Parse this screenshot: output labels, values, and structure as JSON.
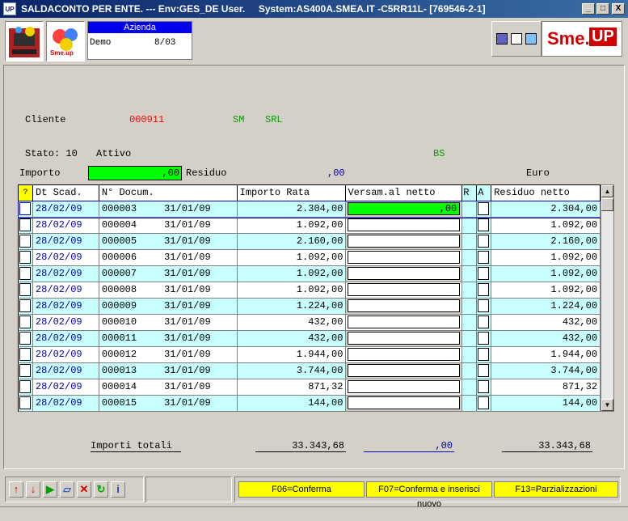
{
  "window": {
    "app_icon": "UP",
    "title": "SALDACONTO PER ENTE. --- Env:GES_DE User.     System:AS400A.SMEA.IT -C5RR11L- [769546-2-1]",
    "controls": [
      "_",
      "□",
      "X"
    ]
  },
  "header": {
    "azienda_title": "Azienda",
    "azienda_name": "Demo",
    "azienda_period": "8/03",
    "smeup_logo_text": "Sme.",
    "smeup_logo_up": "UP",
    "logo2_text": "Sme.up"
  },
  "client": {
    "label": "Cliente",
    "code": "000911",
    "sm": "SM",
    "srl": "SRL",
    "stato_label": "Stato: 10",
    "stato_value": "Attivo",
    "bs": "BS"
  },
  "amounts": {
    "importo_label": "Importo",
    "importo_value": ",00",
    "residuo_label": "Residuo",
    "residuo_value": ",00",
    "currency": "Euro"
  },
  "table": {
    "headers": [
      "?",
      "Dt Scad.",
      "N° Docum.",
      "Importo Rata",
      "Versam.al netto",
      "R",
      "A",
      "Residuo netto"
    ],
    "rows": [
      {
        "date": "28/02/09",
        "doc": "000003",
        "doc_date": "31/01/09",
        "importo": "2.304,00",
        "versam": ",00",
        "residuo": "2.304,00"
      },
      {
        "date": "28/02/09",
        "doc": "000004",
        "doc_date": "31/01/09",
        "importo": "1.092,00",
        "versam": "",
        "residuo": "1.092,00"
      },
      {
        "date": "28/02/09",
        "doc": "000005",
        "doc_date": "31/01/09",
        "importo": "2.160,00",
        "versam": "",
        "residuo": "2.160,00"
      },
      {
        "date": "28/02/09",
        "doc": "000006",
        "doc_date": "31/01/09",
        "importo": "1.092,00",
        "versam": "",
        "residuo": "1.092,00"
      },
      {
        "date": "28/02/09",
        "doc": "000007",
        "doc_date": "31/01/09",
        "importo": "1.092,00",
        "versam": "",
        "residuo": "1.092,00"
      },
      {
        "date": "28/02/09",
        "doc": "000008",
        "doc_date": "31/01/09",
        "importo": "1.092,00",
        "versam": "",
        "residuo": "1.092,00"
      },
      {
        "date": "28/02/09",
        "doc": "000009",
        "doc_date": "31/01/09",
        "importo": "1.224,00",
        "versam": "",
        "residuo": "1.224,00"
      },
      {
        "date": "28/02/09",
        "doc": "000010",
        "doc_date": "31/01/09",
        "importo": "432,00",
        "versam": "",
        "residuo": "432,00"
      },
      {
        "date": "28/02/09",
        "doc": "000011",
        "doc_date": "31/01/09",
        "importo": "432,00",
        "versam": "",
        "residuo": "432,00"
      },
      {
        "date": "28/02/09",
        "doc": "000012",
        "doc_date": "31/01/09",
        "importo": "1.944,00",
        "versam": "",
        "residuo": "1.944,00"
      },
      {
        "date": "28/02/09",
        "doc": "000013",
        "doc_date": "31/01/09",
        "importo": "3.744,00",
        "versam": "",
        "residuo": "3.744,00"
      },
      {
        "date": "28/02/09",
        "doc": "000014",
        "doc_date": "31/01/09",
        "importo": "871,32",
        "versam": "",
        "residuo": "871,32"
      },
      {
        "date": "28/02/09",
        "doc": "000015",
        "doc_date": "31/01/09",
        "importo": "144,00",
        "versam": "",
        "residuo": "144,00"
      }
    ]
  },
  "totals": {
    "label": "Importi totali",
    "importo": "33.343,68",
    "versam": ",00",
    "residuo": "33.343,68"
  },
  "toolbar": {
    "icons": [
      "arrow-up-icon",
      "arrow-down-icon",
      "play-icon",
      "eraser-icon",
      "delete-icon",
      "refresh-icon",
      "info-icon"
    ],
    "f06": "F06=Conferma",
    "f07": "F07=Conferma e inserisci nuovo",
    "f13": "F13=Parzializzazioni"
  },
  "colors": {
    "titlebar": "#0a246a",
    "row_highlight": "#c8ffff",
    "input_active": "#00ff00",
    "fkey": "#ffff00",
    "client_code": "#ff0000",
    "green_text": "#00a000"
  }
}
